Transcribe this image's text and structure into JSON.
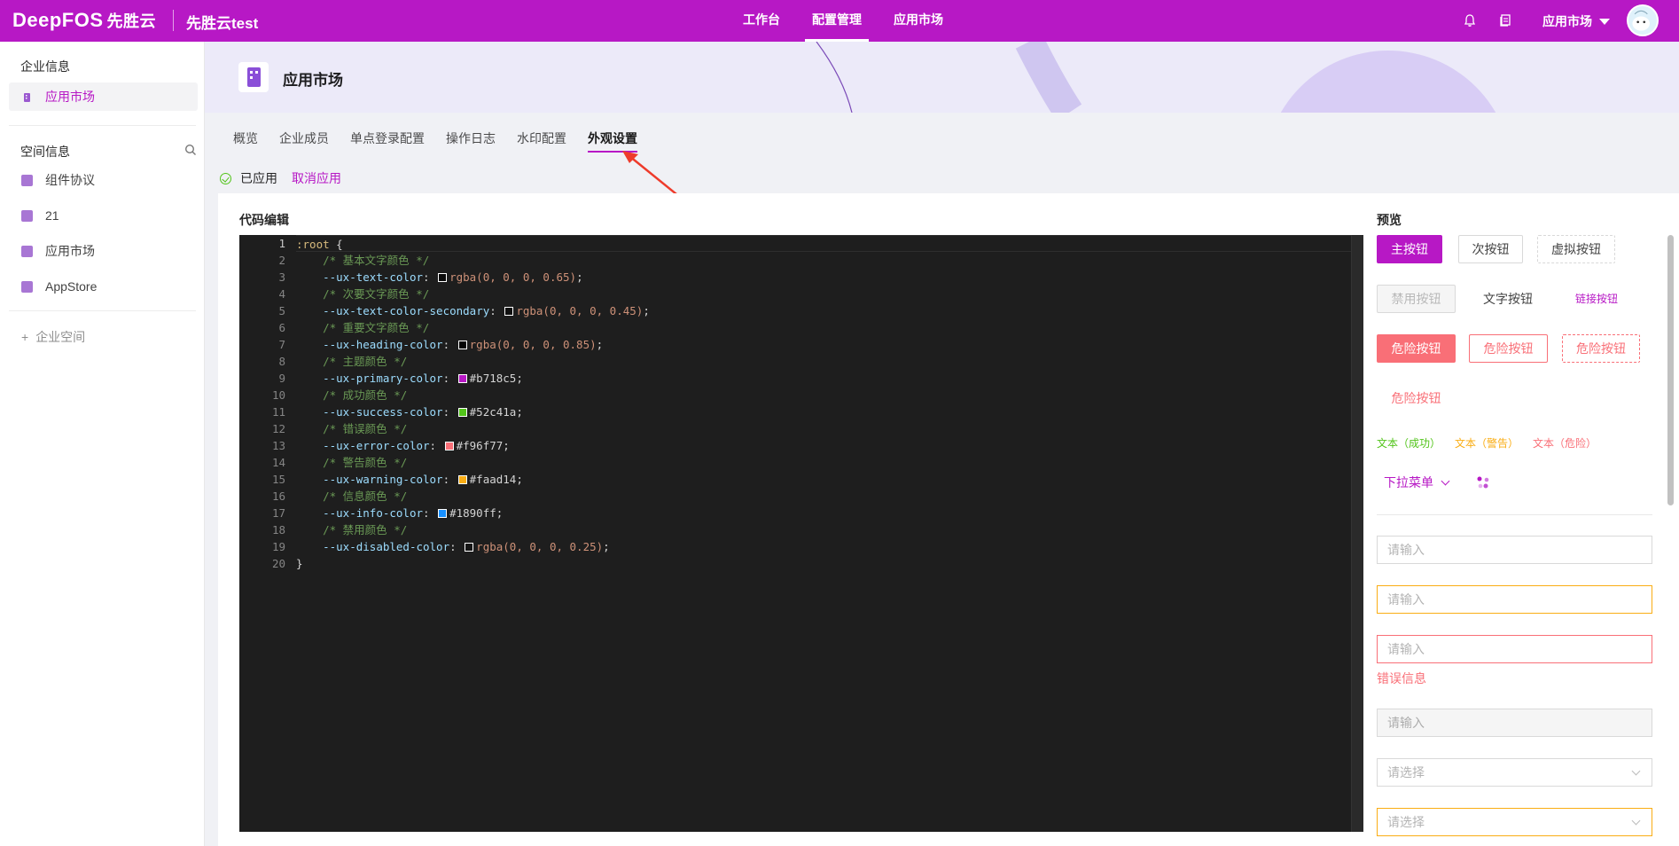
{
  "topbar": {
    "logo_text": "DeepFOS",
    "logo_cn": "先胜云",
    "tenant": "先胜云test",
    "nav": [
      {
        "label": "工作台",
        "active": false
      },
      {
        "label": "配置管理",
        "active": true
      },
      {
        "label": "应用市场",
        "active": false
      }
    ],
    "user_menu": "应用市场",
    "icons": {
      "notify": "bell-icon",
      "docs": "document-icon",
      "caret": "caret-down-icon"
    }
  },
  "sidebar": {
    "group1_title": "企业信息",
    "group1_items": [
      {
        "label": "应用市场",
        "active": true
      }
    ],
    "group2_title": "空间信息",
    "group2_items": [
      {
        "label": "组件协议"
      },
      {
        "label": "21"
      },
      {
        "label": "应用市场"
      },
      {
        "label": "AppStore"
      }
    ],
    "add_space": "企业空间"
  },
  "header": {
    "title": "应用市场"
  },
  "tabs": [
    {
      "label": "概览",
      "active": false
    },
    {
      "label": "企业成员",
      "active": false
    },
    {
      "label": "单点登录配置",
      "active": false
    },
    {
      "label": "操作日志",
      "active": false
    },
    {
      "label": "水印配置",
      "active": false
    },
    {
      "label": "外观设置",
      "active": true
    }
  ],
  "status": {
    "applied": "已应用",
    "cancel": "取消应用"
  },
  "editor": {
    "title": "代码编辑",
    "lines": [
      {
        "n": "1",
        "selector": ":root",
        "brace": " {"
      },
      {
        "n": "2",
        "comment": "/* 基本文字颜色 */"
      },
      {
        "n": "3",
        "prop": "--ux-text-color",
        "swatch": "rgba(0,0,0,0.65)",
        "value": "rgba(0, 0, 0, 0.65)"
      },
      {
        "n": "4",
        "comment": "/* 次要文字颜色 */"
      },
      {
        "n": "5",
        "prop": "--ux-text-color-secondary",
        "swatch": "rgba(0,0,0,0.45)",
        "value": "rgba(0, 0, 0, 0.45)"
      },
      {
        "n": "6",
        "comment": "/* 重要文字颜色 */"
      },
      {
        "n": "7",
        "prop": "--ux-heading-color",
        "swatch": "rgba(0,0,0,0.85)",
        "value": "rgba(0, 0, 0, 0.85)"
      },
      {
        "n": "8",
        "comment": "/* 主题颜色 */"
      },
      {
        "n": "9",
        "prop": "--ux-primary-color",
        "swatch": "#b718c5",
        "value": "#b718c5"
      },
      {
        "n": "10",
        "comment": "/* 成功颜色 */"
      },
      {
        "n": "11",
        "prop": "--ux-success-color",
        "swatch": "#52c41a",
        "value": "#52c41a"
      },
      {
        "n": "12",
        "comment": "/* 错误颜色 */"
      },
      {
        "n": "13",
        "prop": "--ux-error-color",
        "swatch": "#f96f77",
        "value": "#f96f77"
      },
      {
        "n": "14",
        "comment": "/* 警告颜色 */"
      },
      {
        "n": "15",
        "prop": "--ux-warning-color",
        "swatch": "#faad14",
        "value": "#faad14"
      },
      {
        "n": "16",
        "comment": "/* 信息颜色 */"
      },
      {
        "n": "17",
        "prop": "--ux-info-color",
        "swatch": "#1890ff",
        "value": "#1890ff"
      },
      {
        "n": "18",
        "comment": "/* 禁用颜色 */"
      },
      {
        "n": "19",
        "prop": "--ux-disabled-color",
        "swatch": "rgba(0,0,0,0.25)",
        "value": "rgba(0, 0, 0, 0.25)"
      },
      {
        "n": "20",
        "close": "}"
      }
    ]
  },
  "preview": {
    "title": "预览",
    "buttons": {
      "primary": "主按钮",
      "secondary": "次按钮",
      "dashed": "虚拟按钮",
      "disabled": "禁用按钮",
      "text": "文字按钮",
      "link": "链接按钮",
      "danger": "危险按钮",
      "danger_ghost": "危险按钮",
      "danger_dashed": "危险按钮",
      "danger_text": "危险按钮"
    },
    "texts": {
      "success": "文本（成功）",
      "warning": "文本（警告）",
      "danger": "文本（危险）"
    },
    "dropdown": "下拉菜单",
    "inputs": {
      "placeholder": "请输入",
      "select_placeholder": "请选择",
      "error_msg": "错误信息"
    }
  },
  "colors": {
    "primary": "#b718c5",
    "success": "#52c41a",
    "warning": "#faad14",
    "error": "#f96f77",
    "info": "#1890ff"
  }
}
